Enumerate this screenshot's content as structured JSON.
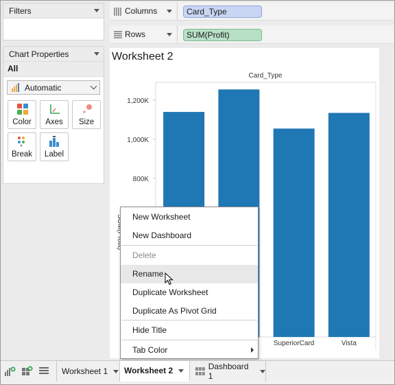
{
  "filters": {
    "title": "Filters"
  },
  "chart_properties": {
    "title": "Chart Properties",
    "all_label": "All",
    "mark_type": "Automatic",
    "buttons": [
      "Color",
      "Axes",
      "Size",
      "Break",
      "Label"
    ]
  },
  "shelves": {
    "columns": {
      "label": "Columns",
      "pill": "Card_Type"
    },
    "rows": {
      "label": "Rows",
      "pill": "SUM(Profit)"
    }
  },
  "worksheet": {
    "title": "Worksheet 2"
  },
  "chart_data": {
    "type": "bar",
    "header": "Card_Type",
    "ylabel": "SUM(Profit)",
    "yticks": [
      "800K",
      "1,000K",
      "1,200K"
    ],
    "ytick_values": [
      800000,
      1000000,
      1200000
    ],
    "categories": [
      "",
      "",
      "SuperiorCard",
      "Vista"
    ],
    "values": [
      1140000,
      1255000,
      1055000,
      1135000
    ],
    "color": "#1f77b4",
    "grid": false
  },
  "context_menu": {
    "items": [
      {
        "label": "New Worksheet",
        "state": "normal"
      },
      {
        "label": "New Dashboard",
        "state": "normal"
      },
      {
        "label": "Delete",
        "state": "disabled"
      },
      {
        "label": "Rename",
        "state": "hover"
      },
      {
        "label": "Duplicate Worksheet",
        "state": "normal"
      },
      {
        "label": "Duplicate As Pivot Grid",
        "state": "normal"
      },
      {
        "label": "Hide Title",
        "state": "normal"
      },
      {
        "label": "Tab Color",
        "state": "submenu"
      }
    ]
  },
  "tabs": {
    "items": [
      {
        "label": "Worksheet 1",
        "active": false
      },
      {
        "label": "Worksheet 2",
        "active": true
      },
      {
        "label": "Dashboard 1",
        "active": false
      }
    ]
  },
  "icons": {
    "new_worksheet": "new-worksheet-icon",
    "new_dashboard": "new-dashboard-icon",
    "sheet_list": "sheet-list-icon"
  }
}
